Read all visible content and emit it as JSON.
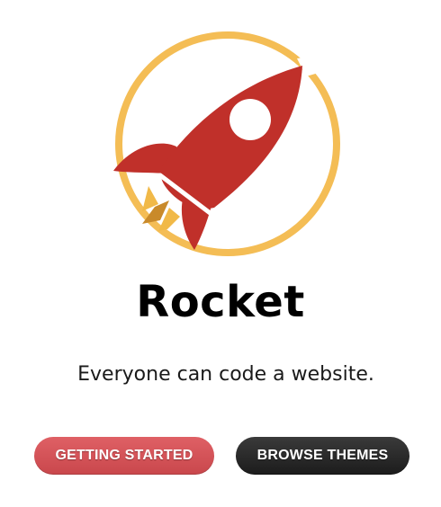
{
  "logo": {
    "icon": "rocket-icon",
    "colors": {
      "ring": "#f4bd55",
      "body": "#c0302a",
      "flame_light": "#f1b948",
      "flame_dark": "#c98a2a",
      "window": "#ffffff"
    }
  },
  "hero": {
    "title": "Rocket",
    "tagline": "Everyone can code a website."
  },
  "actions": {
    "primary_label": "GETTING STARTED",
    "secondary_label": "BROWSE THEMES",
    "colors": {
      "primary": "#d9575b",
      "secondary": "#262626"
    }
  }
}
